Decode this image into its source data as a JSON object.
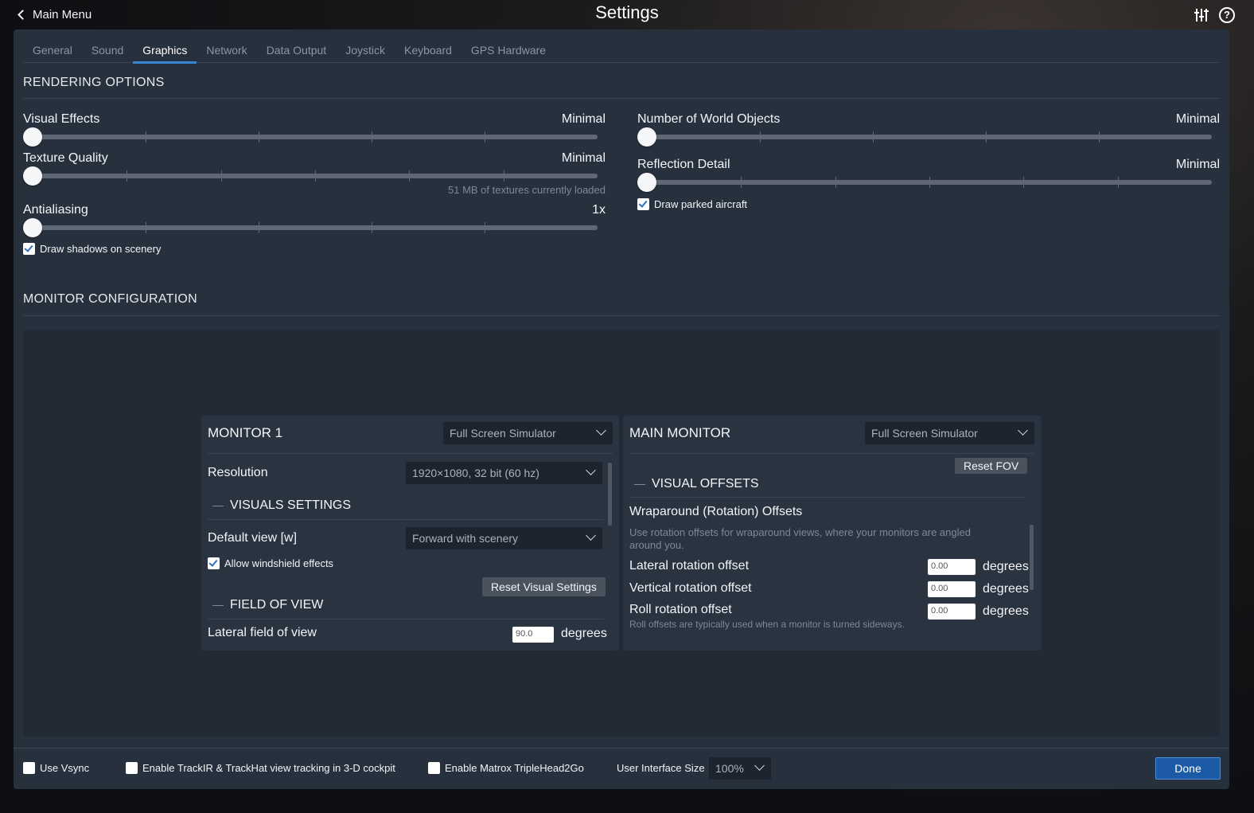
{
  "header": {
    "back_label": "Main Menu",
    "title": "Settings",
    "icons": [
      "sliders-icon",
      "help-icon"
    ],
    "help_glyph": "?"
  },
  "tabs": [
    "General",
    "Sound",
    "Graphics",
    "Network",
    "Data Output",
    "Joystick",
    "Keyboard",
    "GPS Hardware"
  ],
  "active_tab": "Graphics",
  "rendering": {
    "title": "RENDERING OPTIONS",
    "visual_effects": {
      "label": "Visual Effects",
      "value": "Minimal",
      "level": 0
    },
    "texture_quality": {
      "label": "Texture Quality",
      "value": "Minimal",
      "level": 0,
      "note": "51 MB of textures currently loaded"
    },
    "antialiasing": {
      "label": "Antialiasing",
      "value": "1x",
      "level": 0
    },
    "draw_shadows": {
      "label": "Draw shadows on scenery",
      "checked": true
    },
    "world_objects": {
      "label": "Number of World Objects",
      "value": "Minimal",
      "level": 0
    },
    "reflection_detail": {
      "label": "Reflection Detail",
      "value": "Minimal",
      "level": 0
    },
    "draw_parked": {
      "label": "Draw parked aircraft",
      "checked": true
    }
  },
  "monitor": {
    "title": "MONITOR CONFIGURATION",
    "monitor1": {
      "title": "MONITOR 1",
      "mode": "Full Screen Simulator",
      "resolution_label": "Resolution",
      "resolution": "1920×1080, 32 bit (60 hz)",
      "visuals_title": "VISUALS SETTINGS",
      "default_view_label": "Default view [w]",
      "default_view": "Forward with scenery",
      "windshield": {
        "label": "Allow windshield effects",
        "checked": true
      },
      "reset_visual": "Reset Visual Settings",
      "fov_title": "FIELD OF VIEW",
      "lateral_fov_label": "Lateral field of view",
      "lateral_fov": "90.0",
      "unit": "degrees"
    },
    "main": {
      "title": "MAIN MONITOR",
      "mode": "Full Screen Simulator",
      "reset_fov": "Reset FOV",
      "offsets_title": "VISUAL OFFSETS",
      "wrap_title": "Wraparound (Rotation) Offsets",
      "wrap_desc": "Use rotation offsets for wraparound views, where your monitors are angled around you.",
      "lateral_label": "Lateral rotation offset",
      "lateral": "0.00",
      "vertical_label": "Vertical rotation offset",
      "vertical": "0.00",
      "roll_label": "Roll rotation offset",
      "roll": "0.00",
      "roll_desc": "Roll offsets are typically used when a monitor is turned sideways.",
      "unit": "degrees"
    }
  },
  "bottom": {
    "vsync": {
      "label": "Use Vsync",
      "checked": false
    },
    "trackir": {
      "label": "Enable TrackIR & TrackHat view tracking in 3-D cockpit",
      "checked": false
    },
    "matrox": {
      "label": "Enable Matrox TripleHead2Go",
      "checked": false
    },
    "ui_size_label": "User Interface Size",
    "ui_size": "100%",
    "done": "Done"
  }
}
